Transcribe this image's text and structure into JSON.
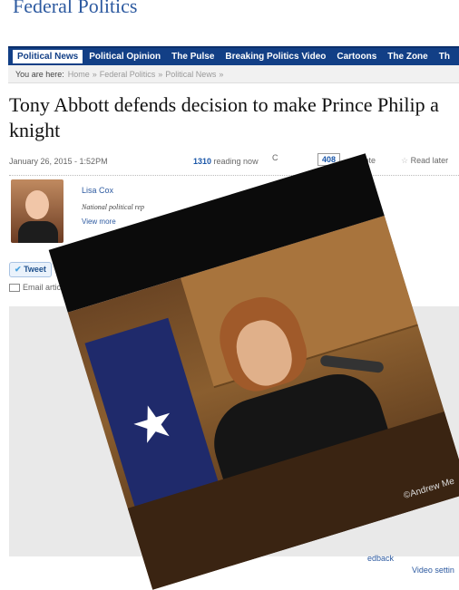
{
  "site": {
    "masthead": "Federal Politics"
  },
  "nav": {
    "items": [
      "Political News",
      "Political Opinion",
      "The Pulse",
      "Breaking Politics Video",
      "Cartoons",
      "The Zone",
      "Th"
    ]
  },
  "breadcrumb": {
    "label": "You are here:",
    "items": [
      "Home",
      "Federal Politics",
      "Political News"
    ]
  },
  "article": {
    "headline": "Tony Abbott defends decision to make Prince Philip a knight",
    "date": "January 26, 2015 - 1:52PM",
    "reading_count": "1310",
    "reading_suffix": " reading now",
    "comments_label": "C",
    "comments_count": "408",
    "vote_label": "Vote",
    "read_later_label": "Read later"
  },
  "author": {
    "name": "Lisa Cox",
    "title": "National political rep",
    "more": "View more"
  },
  "social": {
    "tweet_label": "Tweet",
    "email_label": "Email artic"
  },
  "video": {
    "feedback_label": "edback",
    "settings_label": "Video settin"
  },
  "overlay": {
    "watermark": "©Andrew Me"
  },
  "colors": {
    "nav_bg": "#123f86",
    "link": "#2d5aa0",
    "masthead": "#2d5aa0"
  }
}
